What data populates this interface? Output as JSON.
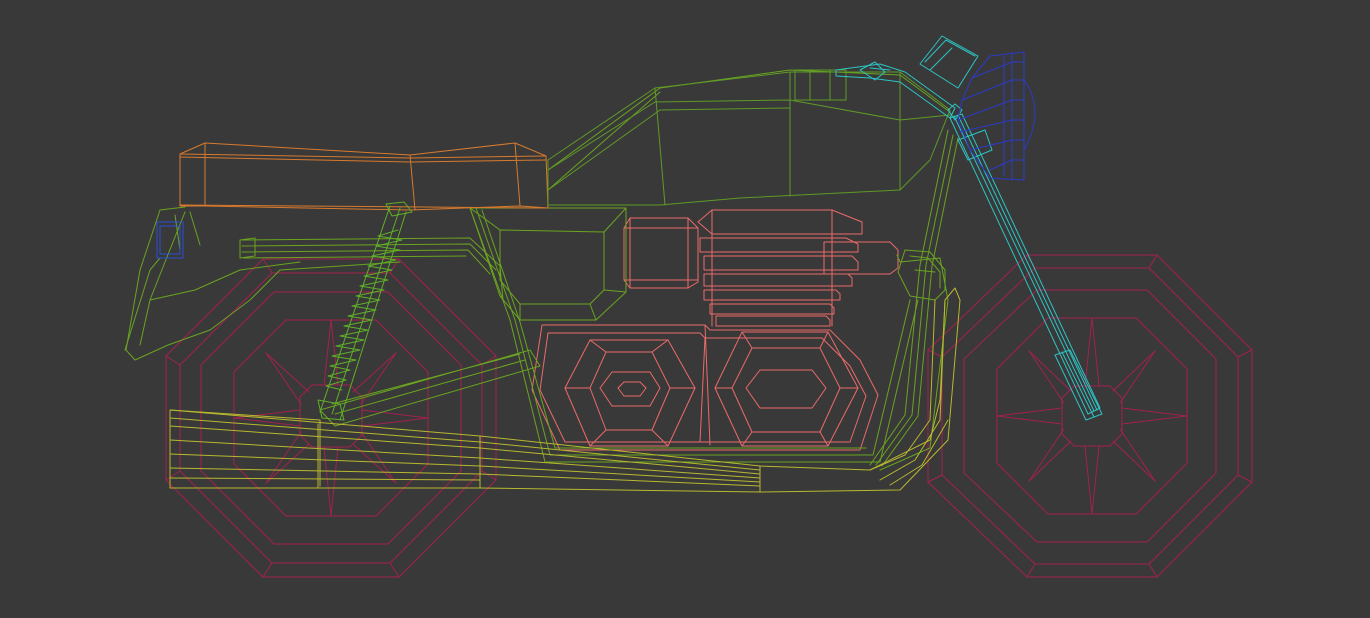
{
  "viewport": {
    "background": "#393939",
    "view": "side-orthographic",
    "display_mode": "wireframe",
    "subject": "motorcycle"
  },
  "colors": {
    "wheels": "#a3214f",
    "frame": "#6aa420",
    "exhaust": "#b8b830",
    "seat": "#d77a2e",
    "tank": "#5f9a27",
    "engine": "#ea6a6a",
    "fork": "#2dc4c4",
    "headlight": "#2c3ac8",
    "shock": "#5fb028",
    "tail_light": "#2c50d8"
  }
}
